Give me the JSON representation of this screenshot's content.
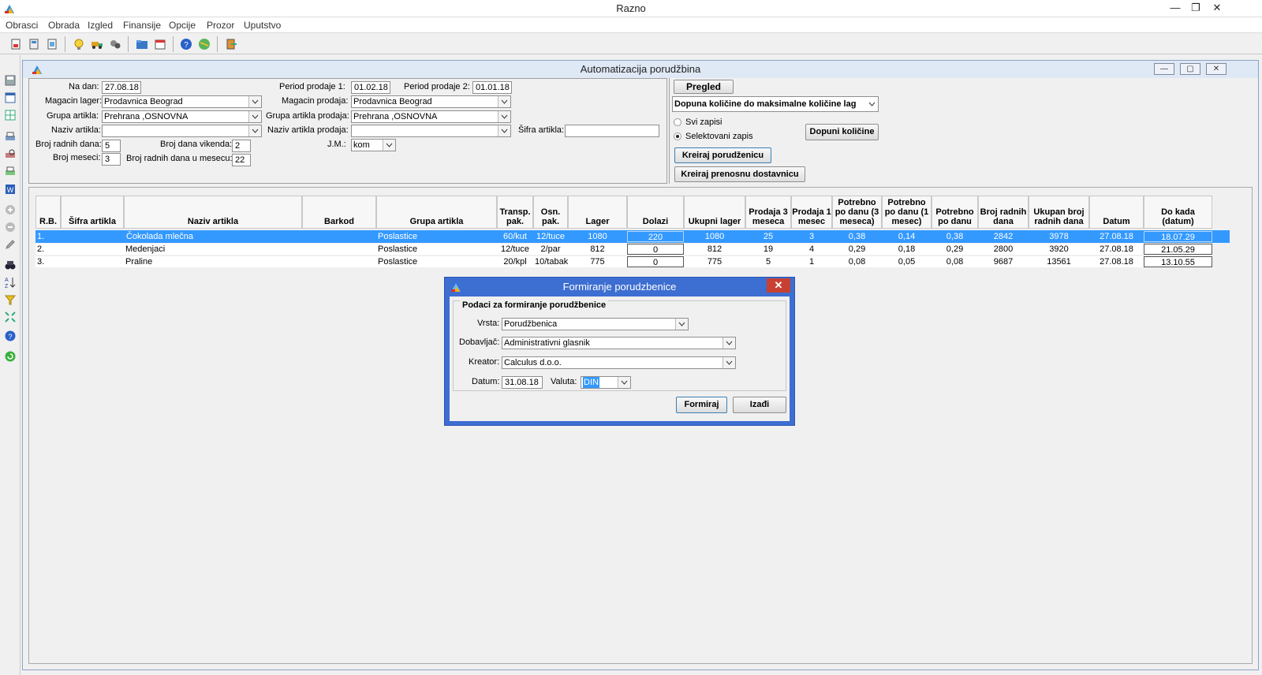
{
  "app": {
    "title": "Razno"
  },
  "menu": [
    "Obrasci",
    "Obrada",
    "Izgled",
    "Finansije",
    "Opcije",
    "Prozor",
    "Uputstvo"
  ],
  "child": {
    "title": "Automatizacija porudžbina",
    "form": {
      "na_dan_label": "Na dan:",
      "na_dan": "27.08.18",
      "period1_label": "Period prodaje 1:",
      "period1": "01.02.18",
      "period2_label": "Period prodaje 2:",
      "period2": "01.01.18",
      "magacin_lager_label": "Magacin lager:",
      "magacin_lager": "Prodavnica Beograd",
      "magacin_prodaja_label": "Magacin prodaja:",
      "magacin_prodaja": "Prodavnica Beograd",
      "grupa_label": "Grupa artikla:",
      "grupa": "Prehrana ,OSNOVNA",
      "grupa_prodaja_label": "Grupa artikla prodaja:",
      "grupa_prodaja": "Prehrana ,OSNOVNA",
      "naziv_label": "Naziv artikla:",
      "naziv": "",
      "naziv_prodaja_label": "Naziv artikla prodaja:",
      "naziv_prodaja": "",
      "sifra_label": "Šifra artikla:",
      "sifra": "",
      "radnih_dana_label": "Broj radnih dana:",
      "radnih_dana": "5",
      "vikenda_label": "Broj dana vikenda:",
      "vikenda": "2",
      "jm_label": "J.M.:",
      "jm": "kom",
      "meseci_label": "Broj meseci:",
      "meseci": "3",
      "radnih_mesec_label": "Broj radnih dana u mesecu:",
      "radnih_mesec": "22"
    },
    "actions": {
      "pregled": "Pregled",
      "mode": "Dopuna količine do maksimalne količine lag",
      "svi_zapisi": "Svi zapisi",
      "selektovani": "Selektovani zapis",
      "dopuni": "Dopuni količine",
      "kreiraj_porudzbenicu": "Kreiraj porudženicu",
      "kreiraj_dostavnicu": "Kreiraj prenosnu dostavnicu"
    },
    "grid": {
      "headers": [
        "R.B.",
        "Šifra artikla",
        "Naziv artikla",
        "Barkod",
        "Grupa artikla",
        "Transp. pak.",
        "Osn. pak.",
        "Lager",
        "Dolazi",
        "Ukupni lager",
        "Prodaja 3 meseca",
        "Prodaja 1 mesec",
        "Potrebno po danu (3 meseca)",
        "Potrebno po danu (1 mesec)",
        "Potrebno po danu",
        "Broj radnih dana",
        "Ukupan broj radnih dana",
        "Datum",
        "Do kada (datum)"
      ],
      "rows": [
        [
          "1.",
          "",
          "Čokolada mlečna",
          "",
          "Poslastice",
          "60/kut",
          "12/tuce",
          "1080",
          "220",
          "1080",
          "25",
          "3",
          "0,38",
          "0,14",
          "0,38",
          "2842",
          "3978",
          "27.08.18",
          "18.07.29"
        ],
        [
          "2.",
          "",
          "Medenjaci",
          "",
          "Poslastice",
          "12/tuce",
          "2/par",
          "812",
          "0",
          "812",
          "19",
          "4",
          "0,29",
          "0,18",
          "0,29",
          "2800",
          "3920",
          "27.08.18",
          "21.05.29"
        ],
        [
          "3.",
          "",
          "Praline",
          "",
          "Poslastice",
          "20/kpl",
          "10/tabak",
          "775",
          "0",
          "775",
          "5",
          "1",
          "0,08",
          "0,05",
          "0,08",
          "9687",
          "13561",
          "27.08.18",
          "13.10.55"
        ]
      ]
    }
  },
  "dialog": {
    "title": "Formiranje porudzbenice",
    "group": "Podaci za formiranje porudžbenice",
    "vrsta_label": "Vrsta:",
    "vrsta": "Porudžbenica",
    "dobavljac_label": "Dobavljač:",
    "dobavljac": "Administrativni glasnik",
    "kreator_label": "Kreator:",
    "kreator": "Calculus d.o.o.",
    "datum_label": "Datum:",
    "datum": "31.08.18",
    "valuta_label": "Valuta:",
    "valuta": "DIN",
    "formiraj": "Formiraj",
    "izadji": "Izađi"
  },
  "colors": {
    "selection": "#3399ff",
    "dialog_frame": "#3d6ed1",
    "close_red": "#c84031"
  }
}
